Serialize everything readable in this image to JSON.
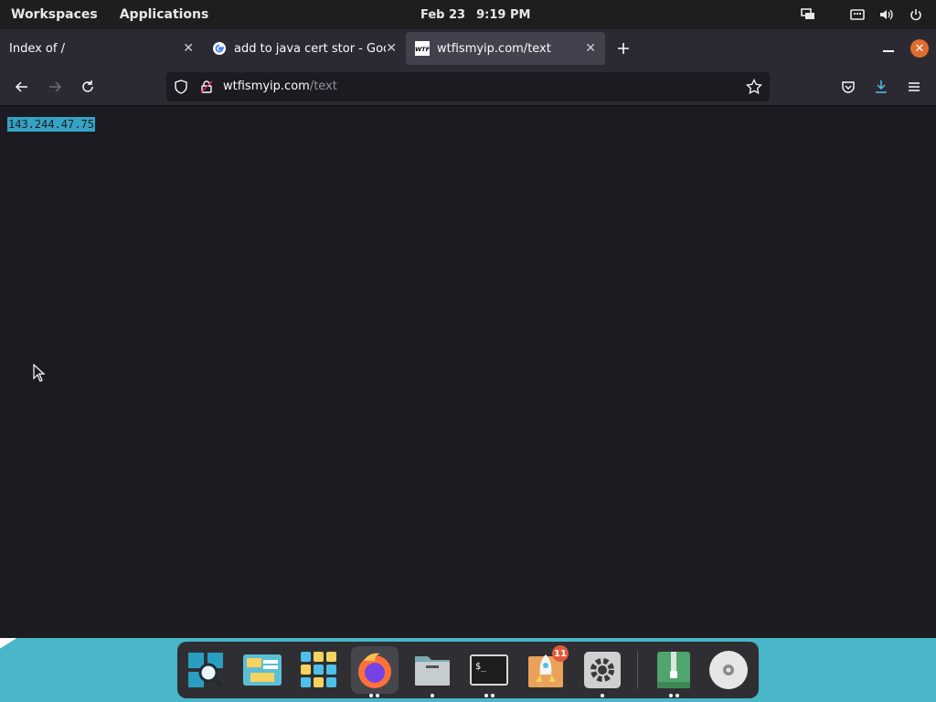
{
  "topbar": {
    "workspaces_label": "Workspaces",
    "applications_label": "Applications",
    "date": "Feb 23",
    "time": "9:19 PM",
    "tray_icons": [
      "display-icon",
      "keyboard-icon",
      "volume-icon",
      "power-icon"
    ]
  },
  "tabs": [
    {
      "title": "Index of /",
      "favicon": "none",
      "active": false
    },
    {
      "title": "add to java cert stor - Goog",
      "favicon": "google-icon",
      "active": false
    },
    {
      "title": "wtfismyip.com/text",
      "favicon": "wtf-icon",
      "active": true
    }
  ],
  "tab_favicon_text": "WTF",
  "navbar": {
    "url_host": "wtfismyip.com",
    "url_path": "/text"
  },
  "page": {
    "ip_address": "143.244.47.75"
  },
  "dock": {
    "items": [
      {
        "name": "search-app-icon"
      },
      {
        "name": "files-manager-icon"
      },
      {
        "name": "app-grid-icon"
      },
      {
        "name": "firefox-icon"
      },
      {
        "name": "file-cabinet-icon"
      },
      {
        "name": "terminal-icon"
      },
      {
        "name": "rocket-store-icon"
      },
      {
        "name": "settings-icon"
      },
      {
        "name": "archive-manager-icon"
      },
      {
        "name": "disk-icon"
      }
    ],
    "store_badge": "11",
    "terminal_prompt": "$_"
  },
  "colors": {
    "content_bg": "#1c1b22",
    "toolbar_bg": "#2b2a33",
    "selection": "#35a3c4",
    "close_button": "#e06c2e",
    "desktop": "#49b7c9"
  }
}
